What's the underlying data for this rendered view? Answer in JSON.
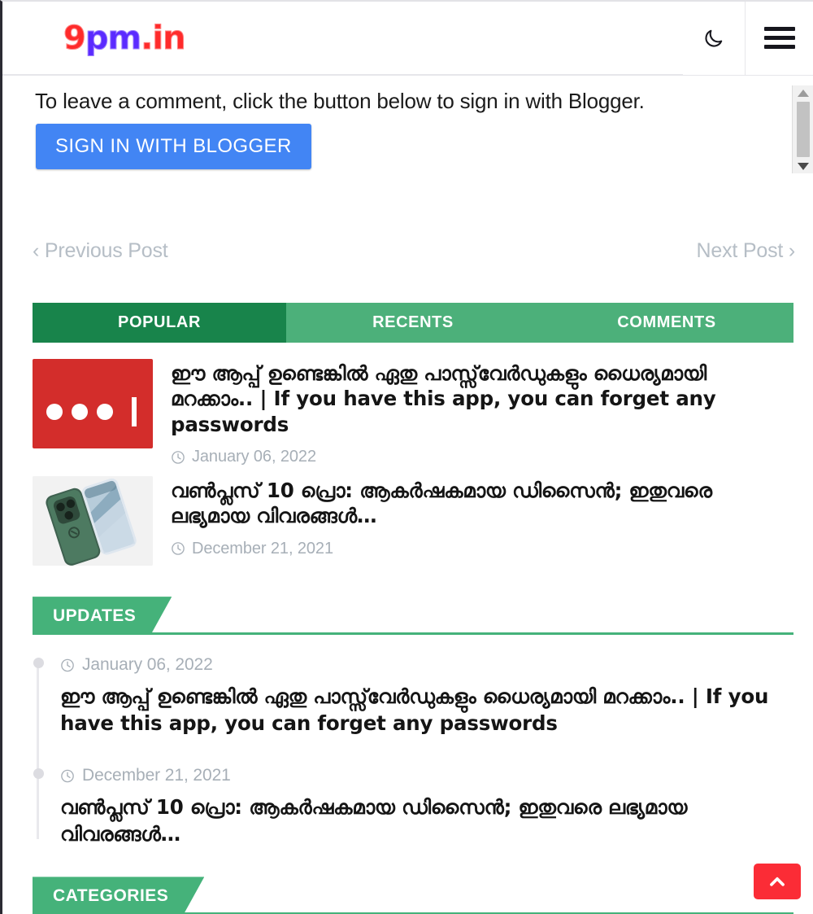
{
  "header": {
    "logo": {
      "part1": "9",
      "part2": "pm",
      "part3": ".in"
    },
    "dark_mode_icon": "moon-icon",
    "menu_icon": "hamburger-menu-icon",
    "divider_color": "#e6e6ea"
  },
  "comment_widget": {
    "prompt": "To leave a comment, click the button below to sign in with Blogger.",
    "signin_label": "SIGN IN WITH BLOGGER",
    "signin_color": "#4285f4",
    "scrollbar": {
      "up_icon": "triangle-up-icon",
      "down_icon": "triangle-down-icon"
    }
  },
  "post_nav": {
    "previous": "‹ Previous Post",
    "next": "Next Post ›",
    "color": "#b6bec6"
  },
  "tabs": {
    "active_color": "#18844b",
    "inactive_color": "#4cb07a",
    "items": [
      {
        "label": "POPULAR",
        "active": true
      },
      {
        "label": "RECENTS",
        "active": false
      },
      {
        "label": "COMMENTS",
        "active": false
      }
    ]
  },
  "popular_posts": [
    {
      "title": "ഈ ആപ്പ് ഉണ്ടെങ്കിൽ ഏതു പാസ്സ്‌വേർഡുകളും ധൈര്യമായി മറക്കാം.. | If you have this app, you can forget any passwords",
      "date": "January 06, 2022",
      "thumbnail": "password-dots-icon",
      "thumbnail_color": "#d32d2b"
    },
    {
      "title": "വൺപ്ലസ് 10 പ്രൊ: ആകർഷകമായ ഡിസൈൻ; ഇതുവരെ ലഭ്യമായ വിവരങ്ങൾ…",
      "date": "December 21, 2021",
      "thumbnail": "oneplus-phone-image",
      "thumbnail_color": "#f2f2f2"
    }
  ],
  "updates_section": {
    "heading": "UPDATES",
    "accent_color": "#45b27a",
    "items": [
      {
        "date": "January 06, 2022",
        "title": "ഈ ആപ്പ് ഉണ്ടെങ്കിൽ ഏതു പാസ്സ്‌വേർഡുകളും ധൈര്യമായി മറക്കാം.. | If you have this app, you can forget any passwords"
      },
      {
        "date": "December 21, 2021",
        "title": "വൺപ്ലസ് 10 പ്രൊ: ആകർഷകമായ ഡിസൈൻ; ഇതുവരെ ലഭ്യമായ വിവരങ്ങൾ…"
      }
    ]
  },
  "categories_section": {
    "heading": "CATEGORIES",
    "accent_color": "#45b27a"
  },
  "scroll_top": {
    "icon": "chevron-up-icon",
    "color": "#fb2c36"
  }
}
